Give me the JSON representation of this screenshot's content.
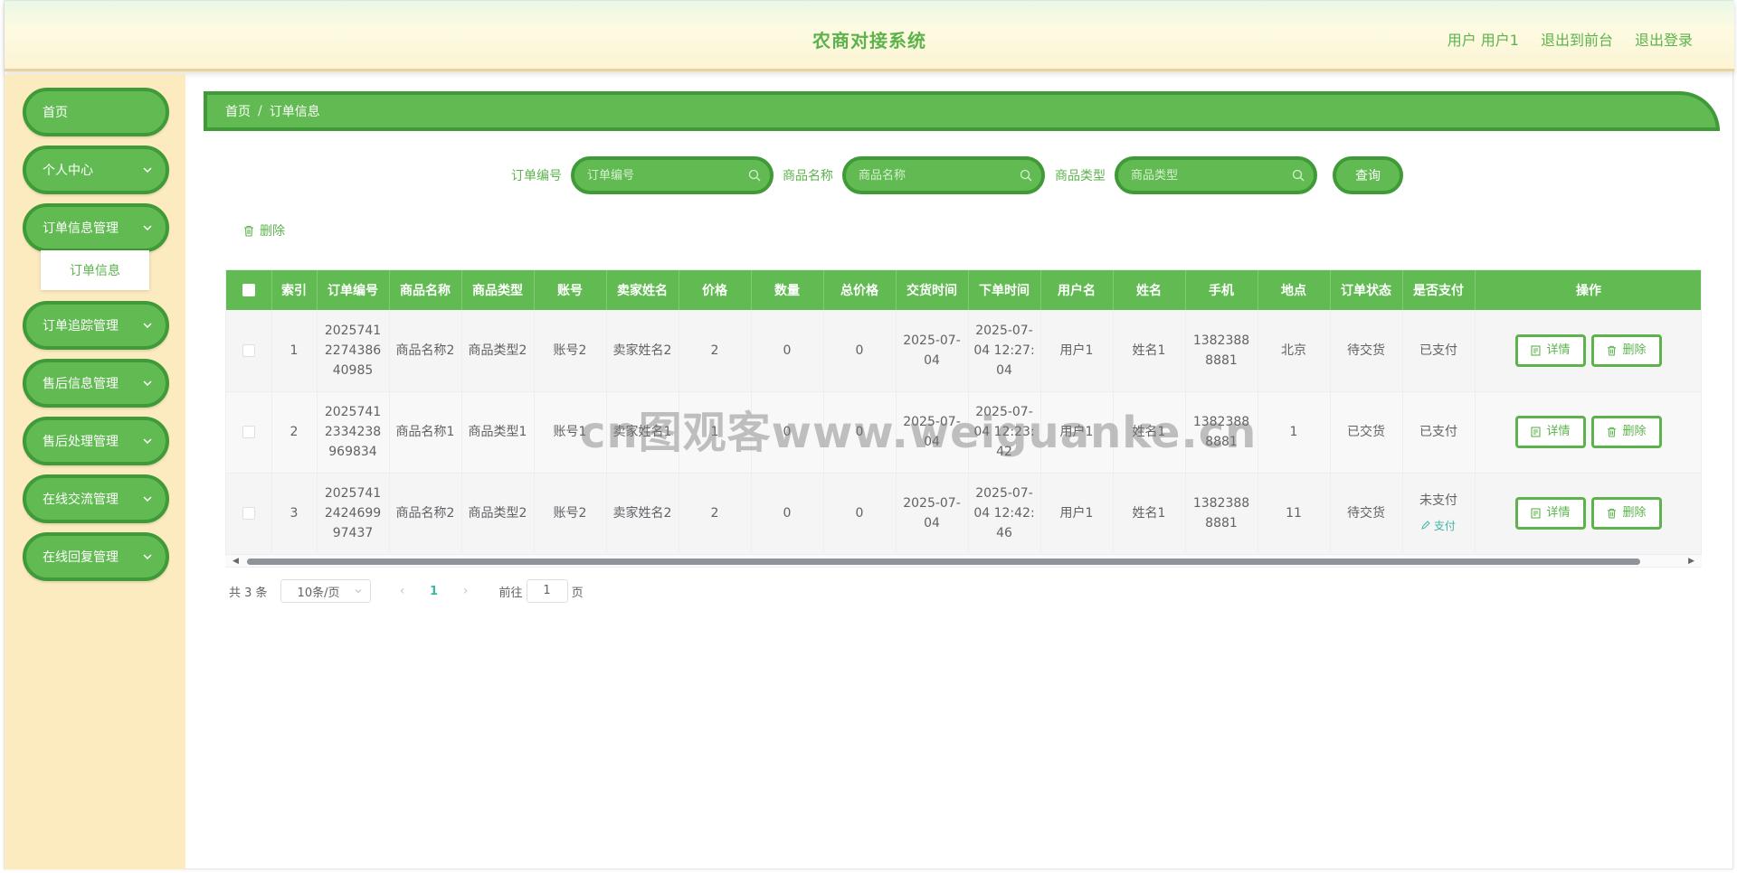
{
  "header": {
    "title": "农商对接系统",
    "user": "用户 用户1",
    "to_front": "退出到前台",
    "logout": "退出登录"
  },
  "sidebar": {
    "items": [
      {
        "label": "首页",
        "has_chevron": false
      },
      {
        "label": "个人中心",
        "has_chevron": true
      },
      {
        "label": "订单信息管理",
        "has_chevron": true
      },
      {
        "label": "订单追踪管理",
        "has_chevron": true
      },
      {
        "label": "售后信息管理",
        "has_chevron": true
      },
      {
        "label": "售后处理管理",
        "has_chevron": true
      },
      {
        "label": "在线交流管理",
        "has_chevron": true
      },
      {
        "label": "在线回复管理",
        "has_chevron": true
      }
    ],
    "sub_item": "订单信息"
  },
  "breadcrumb": {
    "home": "首页",
    "sep": "/",
    "current": "订单信息"
  },
  "search": {
    "order_no_label": "订单编号",
    "order_no_placeholder": "订单编号",
    "product_name_label": "商品名称",
    "product_name_placeholder": "商品名称",
    "product_type_label": "商品类型",
    "product_type_placeholder": "商品类型",
    "query_button": "查询"
  },
  "toolbar": {
    "delete_label": "删除"
  },
  "table": {
    "headers": [
      "索引",
      "订单编号",
      "商品名称",
      "商品类型",
      "账号",
      "卖家姓名",
      "价格",
      "数量",
      "总价格",
      "交货时间",
      "下单时间",
      "用户名",
      "姓名",
      "手机",
      "地点",
      "订单状态",
      "是否支付",
      "操作"
    ],
    "rows": [
      [
        "1",
        "2025741227438640985",
        "商品名称2",
        "商品类型2",
        "账号2",
        "卖家姓名2",
        "2",
        "0",
        "0",
        "2025-07-04",
        "2025-07-04 12:27:04",
        "用户1",
        "姓名1",
        "13823888881",
        "北京",
        "待交货",
        "已支付"
      ],
      [
        "2",
        "20257412334238969834",
        "商品名称1",
        "商品类型1",
        "账号1",
        "卖家姓名1",
        "1",
        "0",
        "0",
        "2025-07-04",
        "2025-07-04 12:23:42",
        "用户1",
        "姓名1",
        "13823888881",
        "1",
        "已交货",
        "已支付"
      ],
      [
        "3",
        "2025741242469997437",
        "商品名称2",
        "商品类型2",
        "账号2",
        "卖家姓名2",
        "2",
        "0",
        "0",
        "2025-07-04",
        "2025-07-04 12:42:46",
        "用户1",
        "姓名1",
        "13823888881",
        "11",
        "待交货",
        "未支付"
      ]
    ],
    "detail_label": "详情",
    "delete_label": "删除",
    "pay_label": "支付"
  },
  "pagination": {
    "total": "共 3 条",
    "page_size": "10条/页",
    "current_page": "1",
    "goto_label": "前往",
    "goto_value": "1",
    "page_suffix": "页"
  },
  "watermark": "cn图观客www.weiguanke.cn",
  "colors": {
    "accent": "#62bb52",
    "accent_border": "#3f9a38",
    "sidebar_bg": "#fdebc0",
    "teal": "#3db6a5"
  }
}
